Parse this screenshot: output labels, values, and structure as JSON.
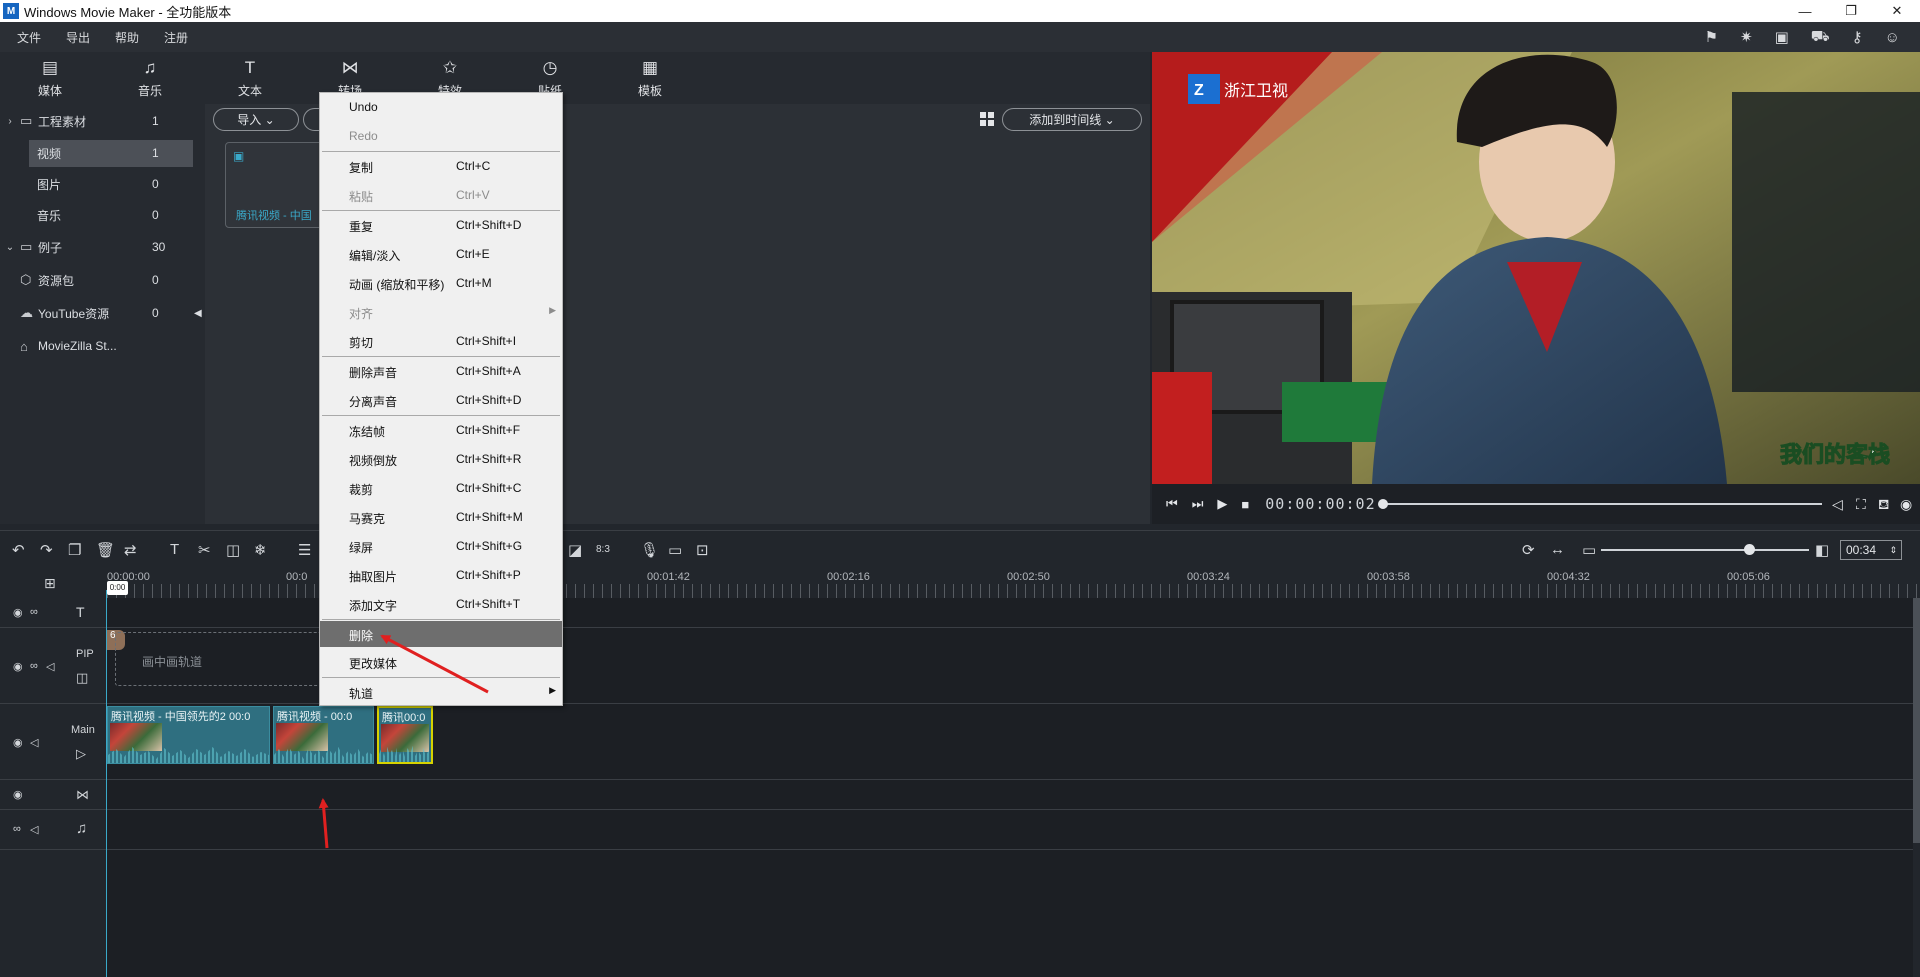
{
  "window": {
    "title": "Windows Movie Maker  - 全功能版本",
    "logo_letter": "M",
    "controls": [
      "minimize",
      "restore",
      "close"
    ]
  },
  "menubar": {
    "items": [
      "文件",
      "导出",
      "帮助",
      "注册"
    ],
    "right_icons": [
      "pin-icon",
      "star-icon",
      "save-icon",
      "cart-icon",
      "key-icon",
      "rating-icon"
    ]
  },
  "tabs": [
    {
      "label": "媒体",
      "icon": "media-icon"
    },
    {
      "label": "音乐",
      "icon": "music-icon"
    },
    {
      "label": "文本",
      "icon": "text-icon"
    },
    {
      "label": "转场",
      "icon": "transition-icon"
    },
    {
      "label": "特效",
      "icon": "effects-icon"
    },
    {
      "label": "贴纸",
      "icon": "sticker-icon"
    },
    {
      "label": "模板",
      "icon": "template-icon"
    }
  ],
  "tree": [
    {
      "label": "工程素材",
      "count": "1",
      "caret": "›"
    },
    {
      "label": "视频",
      "count": "1",
      "selected": true
    },
    {
      "label": "图片",
      "count": "0"
    },
    {
      "label": "音乐",
      "count": "0"
    },
    {
      "label": "例子",
      "count": "30",
      "caret": "⌄"
    },
    {
      "label": "资源包",
      "count": "0"
    },
    {
      "label": "YouTube资源",
      "count": "0"
    },
    {
      "label": "MovieZilla St...",
      "count": ""
    }
  ],
  "media": {
    "import_label": "导入",
    "add_to_timeline_label": "添加到时间线",
    "card_label": "腾讯视频 - 中国"
  },
  "preview": {
    "timecode": "00:00:00:02",
    "station_logo_text": "浙江卫视",
    "show_logo_text": "我们的客栈"
  },
  "timeline": {
    "zoom_value": "00:34",
    "ruler_labels": [
      "00:00:00",
      "00:0",
      "00:01:42",
      "00:02:16",
      "00:02:50",
      "00:03:24",
      "00:03:58",
      "00:04:32",
      "00:05:06"
    ],
    "playhead_label": "0:00",
    "tracks": {
      "pip_label": "PIP",
      "pip_placeholder": "画中画轨道",
      "main_label": "Main"
    },
    "clips": [
      {
        "label": "腾讯视频 - 中国领先的2 00:0"
      },
      {
        "label": "腾讯视频 - 00:0"
      },
      {
        "label": "腾讯00:0"
      }
    ]
  },
  "context_menu": {
    "groups": [
      [
        {
          "label": "Undo",
          "shortcut": ""
        },
        {
          "label": "Redo",
          "shortcut": "",
          "disabled": true
        }
      ],
      [
        {
          "label": "复制",
          "shortcut": "Ctrl+C"
        },
        {
          "label": "粘贴",
          "shortcut": "Ctrl+V",
          "disabled": true
        }
      ],
      [
        {
          "label": "重复",
          "shortcut": "Ctrl+Shift+D"
        },
        {
          "label": "编辑/淡入",
          "shortcut": "Ctrl+E"
        },
        {
          "label": "动画 (缩放和平移)",
          "shortcut": "Ctrl+M"
        },
        {
          "label": "对齐",
          "shortcut": "",
          "disabled": true,
          "submenu": true
        },
        {
          "label": "剪切",
          "shortcut": "Ctrl+Shift+I"
        }
      ],
      [
        {
          "label": "删除声音",
          "shortcut": "Ctrl+Shift+A"
        },
        {
          "label": "分离声音",
          "shortcut": "Ctrl+Shift+D"
        }
      ],
      [
        {
          "label": "冻结帧",
          "shortcut": "Ctrl+Shift+F"
        },
        {
          "label": "视频倒放",
          "shortcut": "Ctrl+Shift+R"
        },
        {
          "label": "裁剪",
          "shortcut": "Ctrl+Shift+C"
        },
        {
          "label": "马赛克",
          "shortcut": "Ctrl+Shift+M"
        },
        {
          "label": "绿屏",
          "shortcut": "Ctrl+Shift+G"
        },
        {
          "label": "抽取图片",
          "shortcut": "Ctrl+Shift+P"
        },
        {
          "label": "添加文字",
          "shortcut": "Ctrl+Shift+T"
        }
      ],
      [
        {
          "label": "删除",
          "shortcut": "",
          "hover": true
        },
        {
          "label": "更改媒体",
          "shortcut": ""
        }
      ],
      [
        {
          "label": "轨道",
          "shortcut": "",
          "submenu": true
        }
      ]
    ]
  },
  "colors": {
    "accent": "#3aa9c9",
    "selected_clip_border": "#d6d200",
    "annotation_arrow": "#e02020"
  }
}
